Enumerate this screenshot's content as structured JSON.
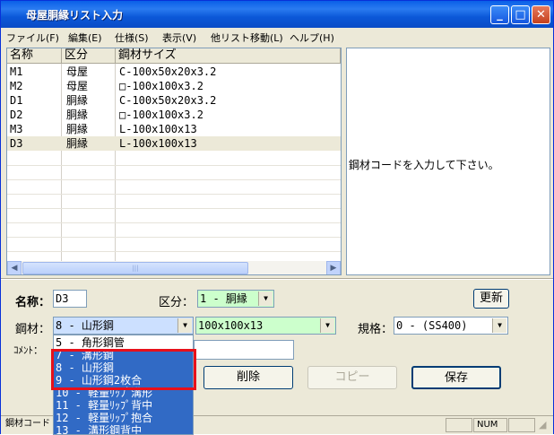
{
  "window": {
    "title": "母屋胴縁リスト入力",
    "minimize": "_",
    "maximize": "□",
    "close": "✕"
  },
  "menu": [
    "ファイル(F)",
    "編集(E)",
    "仕様(S)",
    "表示(V)",
    "他リスト移動(L)",
    "ヘルプ(H)"
  ],
  "list": {
    "columns": [
      "名称",
      "区分",
      "鋼材サイズ"
    ],
    "rows": [
      [
        "M1",
        "母屋",
        "C-100x50x20x3.2"
      ],
      [
        "M2",
        "母屋",
        "□-100x100x3.2"
      ],
      [
        "D1",
        "胴縁",
        "C-100x50x20x3.2"
      ],
      [
        "D2",
        "胴縁",
        "□-100x100x3.2"
      ],
      [
        "M3",
        "胴縁",
        "L-100x100x13"
      ],
      [
        "D3",
        "胴縁",
        "L-100x100x13"
      ]
    ],
    "selected_row": 5
  },
  "message": "鋼材コードを入力して下さい。",
  "form": {
    "name_label": "名称：",
    "name_value": "D3",
    "kubun_label": "区分：",
    "kubun_value": "1 - 胴縁",
    "update_button": "更新",
    "steel_label": "鋼材：",
    "steel_value": "8 - 山形鋼",
    "size_value": "100x100x13",
    "spec_label": "規格：",
    "spec_value": "0 - (SS400)",
    "comment_label": "ｺﾒﾝﾄ：",
    "comment_value": "",
    "delete_button": "削除",
    "copy_button": "コピー",
    "save_button": "保存"
  },
  "dropdown_options": [
    "5 - 角形鋼管",
    "7 - 溝形鋼",
    "8 - 山形鋼",
    "9 - 山形鋼2枚合",
    "10 - 軽量ﾘｯﾌﾟ溝形",
    "11 - 軽量ﾘｯﾌﾟ背中",
    "12 - 軽量ﾘｯﾌﾟ抱合",
    "13 - 溝形鋼背中"
  ],
  "dropdown_highlighted": [
    1,
    2,
    3
  ],
  "status": {
    "left": "鋼材コード",
    "num": "NUM"
  },
  "colors": {
    "title_bar": "#0a5fe8",
    "highlight": "#316ac5",
    "red_frame": "#e8101a",
    "green_field": "#ccffcc"
  }
}
